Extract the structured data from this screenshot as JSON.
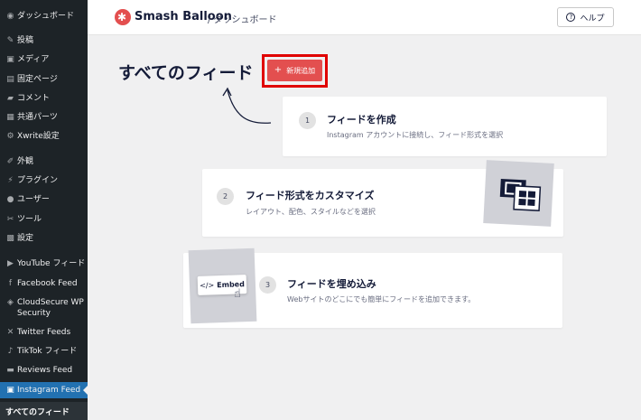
{
  "sidebar": {
    "items": [
      {
        "icon": "dashboard-icon",
        "glyph": "◉",
        "label": "ダッシュボード"
      },
      {
        "icon": "pin-icon",
        "glyph": "✎",
        "label": "投稿"
      },
      {
        "icon": "media-icon",
        "glyph": "▣",
        "label": "メディア"
      },
      {
        "icon": "page-icon",
        "glyph": "▤",
        "label": "固定ページ"
      },
      {
        "icon": "comment-icon",
        "glyph": "▰",
        "label": "コメント"
      },
      {
        "icon": "parts-icon",
        "glyph": "▦",
        "label": "共通パーツ"
      },
      {
        "icon": "gear-icon",
        "glyph": "⚙",
        "label": "Xwrite設定"
      },
      {
        "icon": "brush-icon",
        "glyph": "✐",
        "label": "外観"
      },
      {
        "icon": "plugin-icon",
        "glyph": "⚡",
        "label": "プラグイン"
      },
      {
        "icon": "user-icon",
        "glyph": "●",
        "label": "ユーザー"
      },
      {
        "icon": "wrench-icon",
        "glyph": "✂",
        "label": "ツール"
      },
      {
        "icon": "settings-icon",
        "glyph": "▩",
        "label": "設定"
      },
      {
        "icon": "youtube-icon",
        "glyph": "▶",
        "label": "YouTube フィード"
      },
      {
        "icon": "facebook-icon",
        "glyph": "f",
        "label": "Facebook Feed"
      },
      {
        "icon": "shield-icon",
        "glyph": "◈",
        "label": "CloudSecure WP Security"
      },
      {
        "icon": "x-icon",
        "glyph": "✕",
        "label": "Twitter Feeds"
      },
      {
        "icon": "tiktok-icon",
        "glyph": "♪",
        "label": "TikTok フィード"
      },
      {
        "icon": "reviews-icon",
        "glyph": "▬",
        "label": "Reviews Feed"
      },
      {
        "icon": "instagram-icon",
        "glyph": "▣",
        "label": "Instagram Feed"
      }
    ],
    "submenu_active": "すべてのフィード"
  },
  "header": {
    "brand": "Smash Balloon",
    "breadcrumb": "/ ダッシュボード",
    "help_label": "ヘルプ"
  },
  "main": {
    "title": "すべてのフィード",
    "add_button": "新規追加",
    "steps": [
      {
        "number": "1",
        "title": "フィードを作成",
        "desc": "Instagram アカウントに接続し、フィード形式を選択"
      },
      {
        "number": "2",
        "title": "フィード形式をカスタマイズ",
        "desc": "レイアウト、配色、スタイルなどを選択"
      },
      {
        "number": "3",
        "title": "フィードを埋め込み",
        "desc": "Webサイトのどこにでも簡単にフィードを追加できます。"
      }
    ],
    "embed_chip": {
      "code": "</>",
      "label": "Embed"
    }
  }
}
